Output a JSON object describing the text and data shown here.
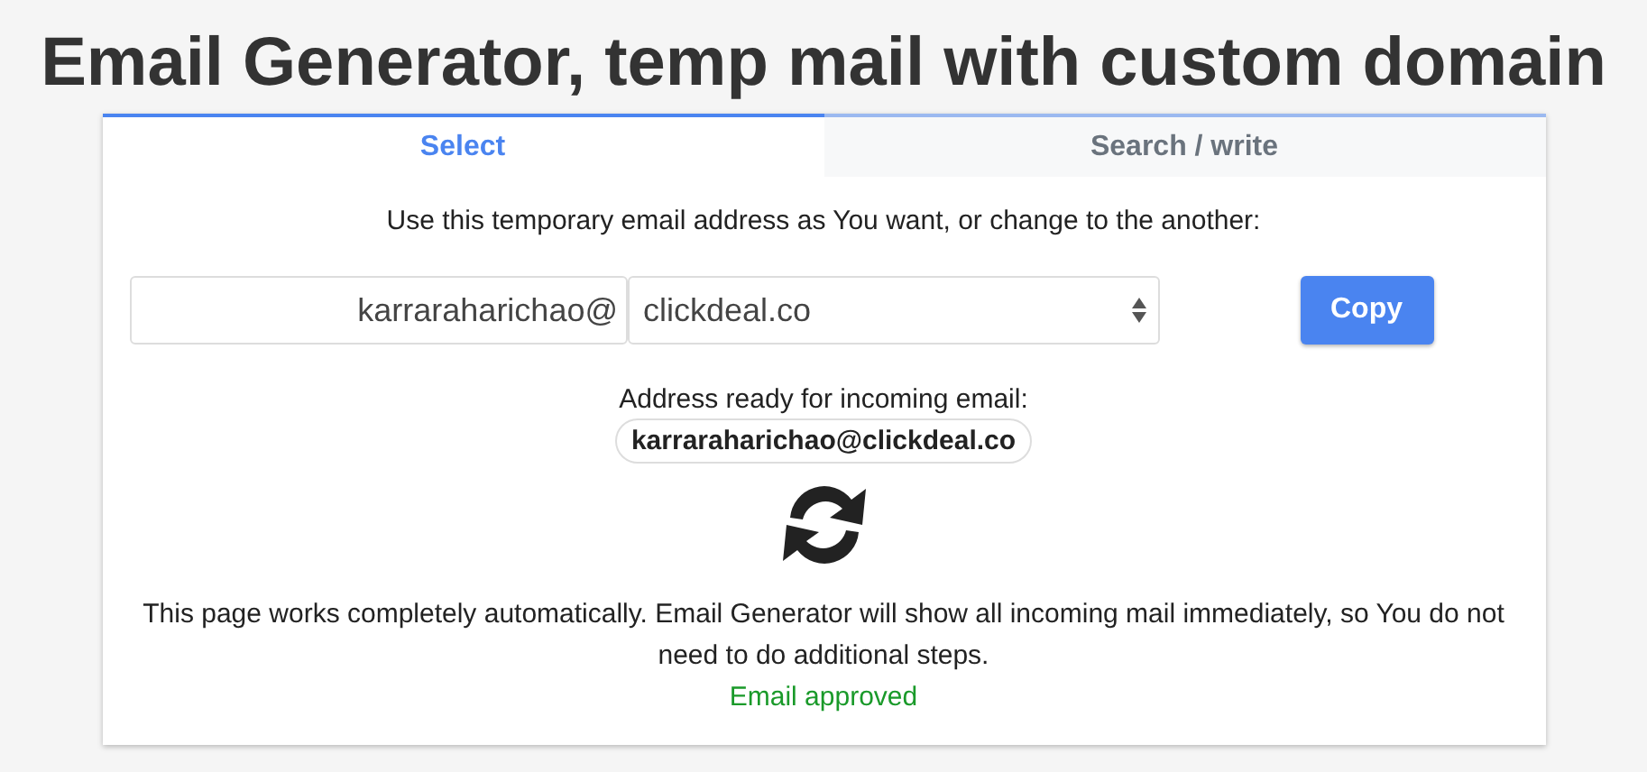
{
  "title": "Email Generator, temp mail with custom domain",
  "tabs": [
    {
      "label": "Select",
      "selected": true
    },
    {
      "label": "Search / write",
      "selected": false
    }
  ],
  "instruction": "Use this temporary email address as You want, or change to the another:",
  "username": {
    "value": "karraraharichao@"
  },
  "domain": {
    "value": "clickdeal.co"
  },
  "copy_button": "Copy",
  "ready_label": "Address ready for incoming email:",
  "address": "karraraharichao@clickdeal.co",
  "description": "This page works completely automatically. Email Generator will show all incoming mail immediately, so You do not need to do additional steps.",
  "status": "Email approved"
}
